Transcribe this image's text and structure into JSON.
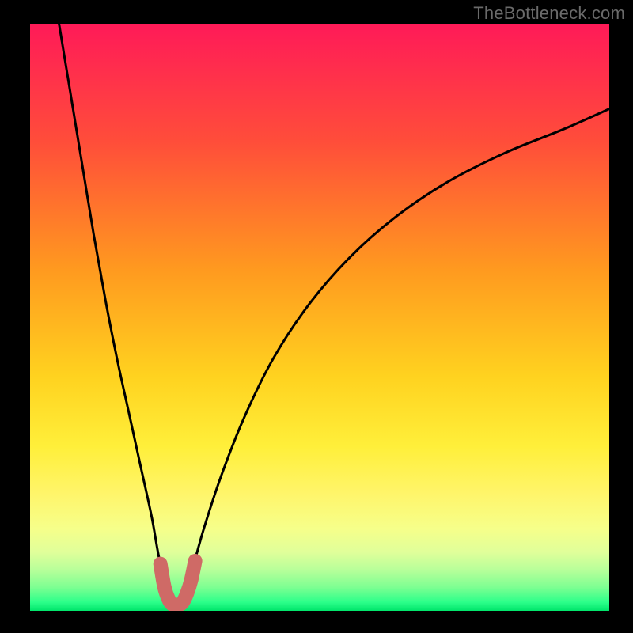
{
  "watermark": "TheBottleneck.com",
  "chart_data": {
    "type": "line",
    "title": "",
    "xlabel": "",
    "ylabel": "",
    "xlim": [
      0,
      100
    ],
    "ylim": [
      0,
      100
    ],
    "gradient_stops": [
      {
        "offset": 0.0,
        "color": "#ff1a58"
      },
      {
        "offset": 0.2,
        "color": "#ff4d3a"
      },
      {
        "offset": 0.42,
        "color": "#ff9a1f"
      },
      {
        "offset": 0.6,
        "color": "#ffd21f"
      },
      {
        "offset": 0.72,
        "color": "#ffef3a"
      },
      {
        "offset": 0.8,
        "color": "#fff56a"
      },
      {
        "offset": 0.86,
        "color": "#f6ff8a"
      },
      {
        "offset": 0.9,
        "color": "#e0ff9a"
      },
      {
        "offset": 0.93,
        "color": "#b8ff9a"
      },
      {
        "offset": 0.96,
        "color": "#7dff92"
      },
      {
        "offset": 0.985,
        "color": "#2dff8a"
      },
      {
        "offset": 1.0,
        "color": "#00e56b"
      }
    ],
    "series": [
      {
        "name": "bottleneck-curve",
        "x": [
          5,
          7,
          9,
          11,
          13,
          15,
          17,
          19,
          21,
          22.5,
          24.5,
          25.5,
          26.5,
          28,
          30,
          33,
          37,
          42,
          48,
          55,
          63,
          72,
          82,
          92,
          100
        ],
        "y": [
          100,
          88,
          76,
          64,
          53,
          43,
          34,
          25,
          16,
          8,
          2,
          1,
          2,
          7,
          14,
          23,
          33,
          43,
          52,
          60,
          67,
          73,
          78,
          82,
          85.5
        ]
      }
    ],
    "highlight": {
      "name": "optimal-range-u",
      "color": "#cf6a66",
      "x": [
        22.5,
        23.2,
        24.0,
        24.7,
        25.5,
        26.3,
        27.1,
        27.8,
        28.5
      ],
      "y": [
        8.0,
        4.0,
        1.8,
        1.0,
        1.0,
        1.4,
        3.0,
        5.2,
        8.5
      ]
    }
  }
}
